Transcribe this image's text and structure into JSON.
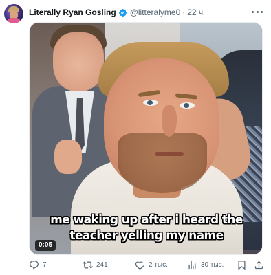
{
  "tweet": {
    "display_name": "Literally Ryan Gosling",
    "handle": "@litteralyme0",
    "separator": "·",
    "time": "22 ч",
    "verified": true,
    "media": {
      "caption": "me waking up after i heard the teacher yelling my name",
      "duration": "0:05"
    },
    "actions": {
      "replies": "7",
      "retweets": "241",
      "likes": "2 тыс.",
      "views": "30 тыс."
    }
  },
  "colors": {
    "verified": "#1d9bf0",
    "muted_text": "#536471",
    "primary_text": "#0f1419"
  },
  "icons": {
    "reply": "reply-icon",
    "retweet": "retweet-icon",
    "like": "heart-icon",
    "views": "views-icon",
    "bookmark": "bookmark-icon",
    "share": "share-icon",
    "more": "more-icon",
    "verified": "verified-badge-icon"
  }
}
